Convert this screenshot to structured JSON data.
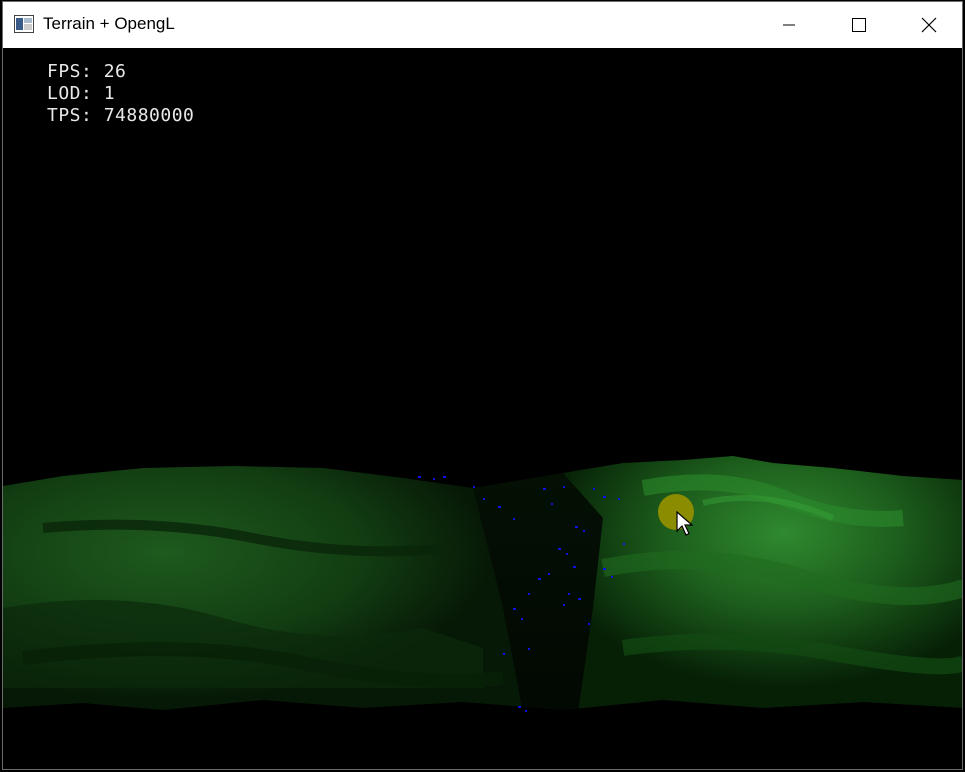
{
  "window": {
    "title": "Terrain + OpengL",
    "controls": {
      "minimize": "minimize-icon",
      "maximize": "maximize-icon",
      "close": "close-icon"
    }
  },
  "hud": {
    "fps_label": "FPS:",
    "fps_value": "26",
    "lod_label": "LOD:",
    "lod_value": "1",
    "tps_label": "TPS:",
    "tps_value": "74880000"
  },
  "colors": {
    "terrain_dark": "#0a2a0a",
    "terrain_mid": "#1f5a1f",
    "terrain_bright": "#2f8a2f",
    "water_points": "#1010e0",
    "cursor_highlight": "#8c8c00",
    "hud_text": "#e8e8e8"
  }
}
